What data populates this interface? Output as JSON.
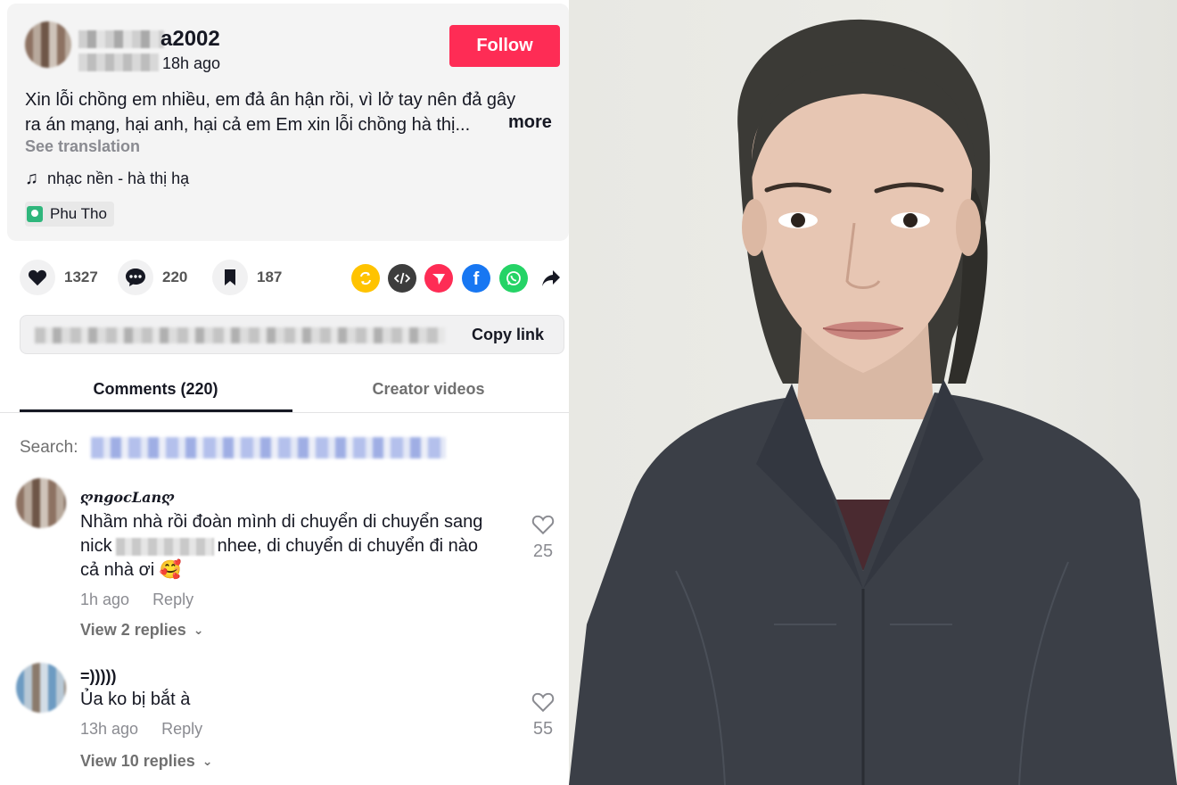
{
  "post": {
    "author_suffix": "a2002",
    "time": "18h ago",
    "follow_label": "Follow",
    "caption_line1": "Xin lỗi chồng em nhiều, em đả ân hận rồi, vì lở tay nên đả gây",
    "caption_line2": "ra án mạng, hại anh, hại cả em Em xin lỗi chồng hà thị...",
    "more_label": "more",
    "see_translation": "See translation",
    "music": "nhạc nền - hà thị hạ",
    "location": "Phu Tho"
  },
  "actions": {
    "likes": "1327",
    "comments": "220",
    "saves": "187"
  },
  "share_icons": [
    "repost-icon",
    "embed-icon",
    "send-icon",
    "facebook-icon",
    "whatsapp-icon",
    "share-arrow-icon"
  ],
  "copy_link_label": "Copy link",
  "tabs": {
    "comments": "Comments (220)",
    "creator": "Creator videos"
  },
  "search_label": "Search:",
  "comments": [
    {
      "name": "ღngocLanღ",
      "text_line1": "Nhầm nhà rồi đoàn mình di chuyển di chuyển sang",
      "text_line2_a": "nick",
      "text_line2_b": "nhee, di chuyển di chuyển đi nào",
      "text_line3": "cả nhà ơi 🥰",
      "time": "1h ago",
      "reply": "Reply",
      "view_replies": "View 2 replies",
      "likes": "25"
    },
    {
      "name": "=)))))",
      "text_line1": "Ủa ko bị bắt à",
      "time": "13h ago",
      "reply": "Reply",
      "view_replies": "View 10 replies",
      "likes": "55"
    }
  ],
  "colors": {
    "follow_bg": "#fe2c55",
    "repost": "#ffc300",
    "embed": "#3d3d3d",
    "send": "#fe2c55",
    "facebook": "#1877f2",
    "whatsapp": "#25d366"
  }
}
